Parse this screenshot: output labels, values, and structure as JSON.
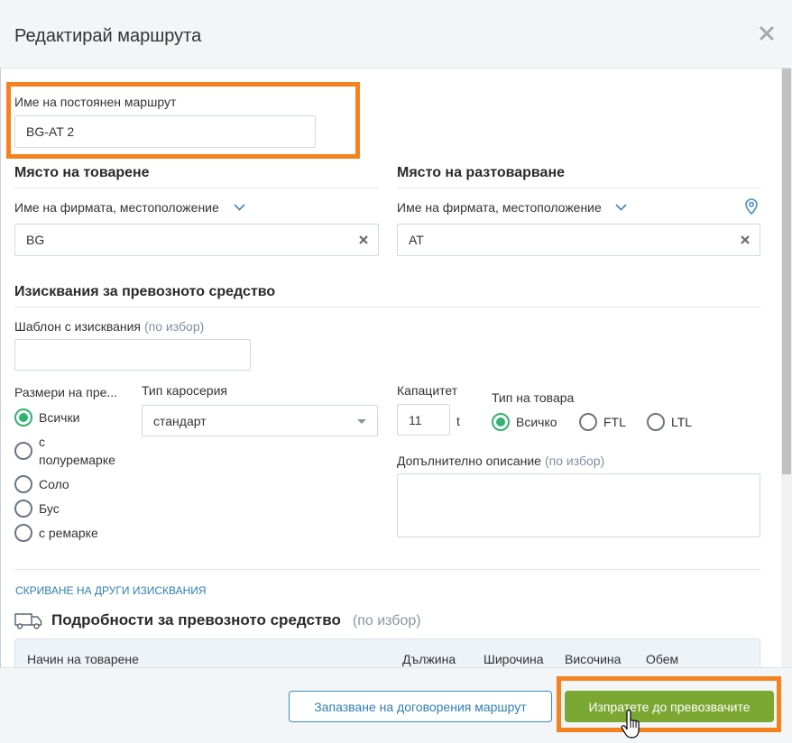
{
  "dialog": {
    "title": "Редактирай маршрута"
  },
  "route_name": {
    "label": "Име на постоянен маршрут",
    "value": "BG-AT 2"
  },
  "loading_place": {
    "heading": "Място на товарене",
    "company_label": "Име на фирмата, местоположение",
    "value": "BG"
  },
  "unloading_place": {
    "heading": "Място на разтоварване",
    "company_label": "Име на фирмата, местоположение",
    "value": "AT"
  },
  "requirements": {
    "heading": "Изисквания за превозното средство",
    "template": {
      "label": "Шаблон с изисквания",
      "optional": "(по избор)",
      "value": ""
    },
    "vehicle_size": {
      "label": "Размери на пре...",
      "selected_index": 0,
      "options": [
        "Всички",
        "с полуремарке",
        "Соло",
        "Бус",
        "с ремарке"
      ]
    },
    "body_type": {
      "label": "Тип каросерия",
      "value": "стандарт"
    },
    "capacity": {
      "label": "Капацитет",
      "value": "11",
      "unit": "t"
    },
    "cargo_type": {
      "label": "Тип на товара",
      "selected_index": 0,
      "options": [
        "Всичко",
        "FTL",
        "LTL"
      ]
    },
    "description": {
      "label": "Допълнително описание",
      "optional": "(по избор)",
      "value": ""
    },
    "toggle_link": "СКРИВАНЕ НА ДРУГИ ИЗИСКВАНИЯ"
  },
  "vehicle_details": {
    "heading": "Подробности за превозното средство",
    "optional": "(по избор)",
    "columns": [
      "Начин на товарене",
      "Дължина",
      "Широчина",
      "Височина",
      "Обем"
    ]
  },
  "footer": {
    "save_button": "Запазване на договорения маршрут",
    "send_button": "Изпратете до превозвачите"
  },
  "icons": {
    "close": "close-icon",
    "clear": "clear-icon",
    "dropdown": "chevron-down-icon",
    "location": "location-pin-icon",
    "select_arrow": "caret-down-icon",
    "truck": "truck-icon",
    "cursor": "hand-pointer-icon"
  },
  "colors": {
    "radio_selected": "#2fb46e",
    "send_button": "#7ba733",
    "link": "#2f7fb6",
    "highlight": "#f5821f",
    "optional_text": "#7f90a3"
  }
}
